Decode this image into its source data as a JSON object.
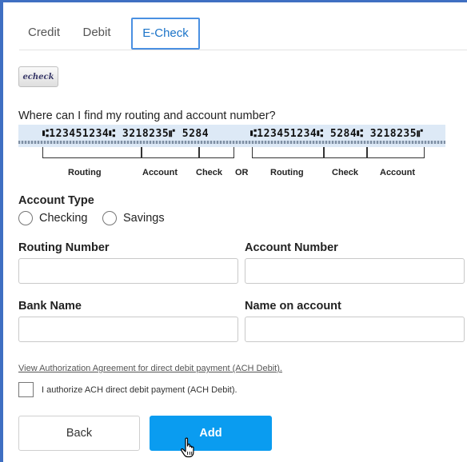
{
  "tabs": [
    {
      "label": "Credit",
      "active": false
    },
    {
      "label": "Debit",
      "active": false
    },
    {
      "label": "E-Check",
      "active": true
    }
  ],
  "logo": {
    "text": "echeck",
    "icon": "echeck-logo"
  },
  "help": {
    "question": "Where can I find my routing and account number?",
    "micr_left": "⑆123451234⑆ 3218235⑈ 5284",
    "micr_right": "⑆123451234⑆ 5284⑆ 3218235⑈",
    "labels": [
      "Routing",
      "Account",
      "Check",
      "OR",
      "Routing",
      "Check",
      "Account"
    ]
  },
  "account_type": {
    "label": "Account Type",
    "options": [
      "Checking",
      "Savings"
    ],
    "selected": null
  },
  "fields": {
    "routing_label": "Routing Number",
    "routing_value": "",
    "account_label": "Account Number",
    "account_value": "",
    "bank_label": "Bank Name",
    "bank_value": "",
    "name_label": "Name on account",
    "name_value": ""
  },
  "authorization": {
    "link_text": "View Authorization Agreement for direct debit payment (ACH Debit).",
    "checkbox_label": "I authorize ACH direct debit payment (ACH Debit).",
    "checked": false
  },
  "buttons": {
    "back": "Back",
    "add": "Add"
  },
  "colors": {
    "accent": "#0a9cf0",
    "tab_border": "#4a90e2",
    "frame": "#3f6fc2"
  }
}
